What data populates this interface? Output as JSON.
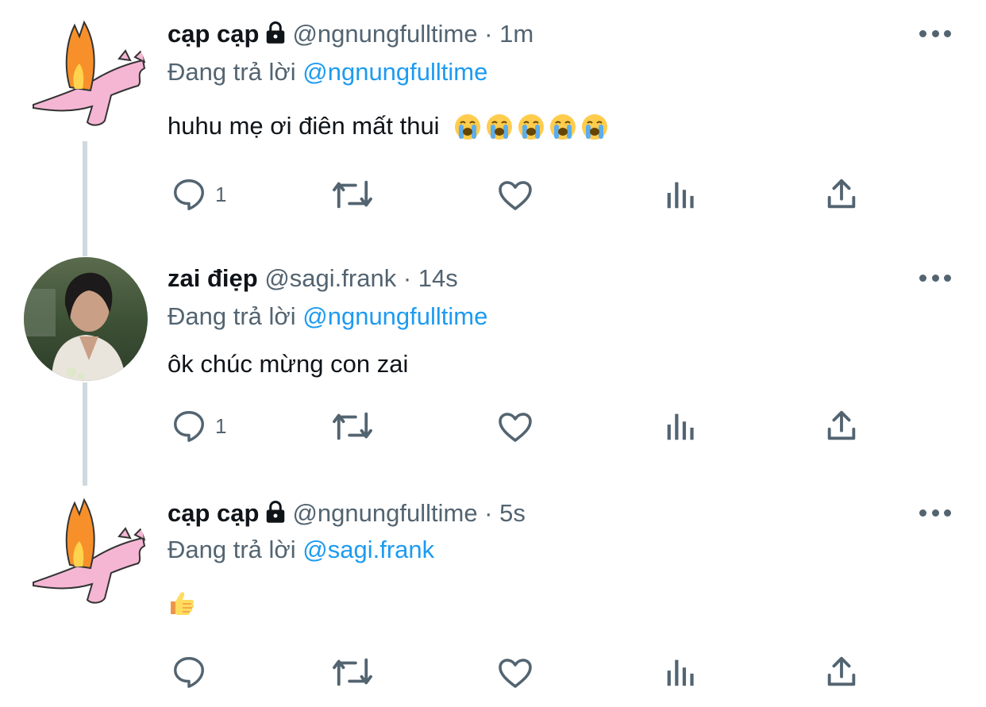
{
  "tweets": [
    {
      "name": "cạp cạp",
      "handle": "@ngnungfulltime",
      "time": "1m",
      "reply_prefix": "Đang trả lời",
      "reply_to": "@ngnungfulltime",
      "text": "huhu mẹ ơi điên mất thui",
      "emoji": "loudly-crying-face x5",
      "reply_count": "1"
    },
    {
      "name": "zai điẹp",
      "handle": "@sagi.frank",
      "time": "14s",
      "reply_prefix": "Đang trả lời",
      "reply_to": "@ngnungfulltime",
      "text": "ôk chúc mừng con zai",
      "reply_count": "1"
    },
    {
      "name": "cạp cạp",
      "handle": "@ngnungfulltime",
      "time": "5s",
      "reply_prefix": "Đang trả lời",
      "reply_to": "@sagi.frank",
      "text": "",
      "emoji": "thumbs-up",
      "reply_count": ""
    }
  ],
  "colors": {
    "accent": "#1d9bf0",
    "secondary": "#536471",
    "thread_line": "#cfd9de"
  }
}
